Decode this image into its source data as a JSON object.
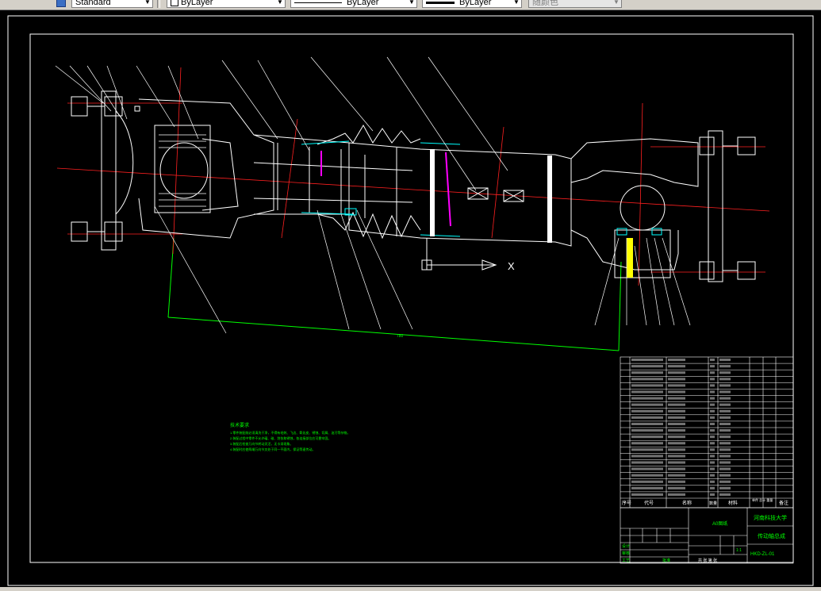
{
  "toolbar": {
    "text_style": "Standard",
    "layer": "ByLayer",
    "linetype": "ByLayer",
    "lineweight": "ByLayer",
    "color": "随颜色"
  },
  "drawing": {
    "axis_x_label": "X",
    "notes_title": "技术要求",
    "notes": [
      "1.零件装配前必须清洗干净，不得有毛刺、飞边、氧化皮、锈蚀、切屑、油污等杂物。",
      "2.装配过程中零件不允许磕、碰、划伤和锈蚀，各连接部位应可靠牢固。",
      "3.装配后检查万向节转动灵活，无卡滞现象。",
      "4.装配时应使两端万向节叉处于同一平面内，保证等速传动。"
    ],
    "title_block": {
      "university": "河南科技大学",
      "drawing_name": "传动轴总成",
      "drawing_number": "HKD-ZL-01",
      "scale": "1:1",
      "sheet_size": "A0图纸",
      "header_seq": "序号",
      "header_code": "代号",
      "header_name": "名称",
      "header_qty": "数量",
      "header_material": "材料",
      "header_weight": "单件 总计 重量",
      "header_remark": "备注",
      "design": "设计",
      "review": "审核",
      "process": "工艺",
      "approve": "批准",
      "sheets": "共 张 第 张"
    }
  }
}
